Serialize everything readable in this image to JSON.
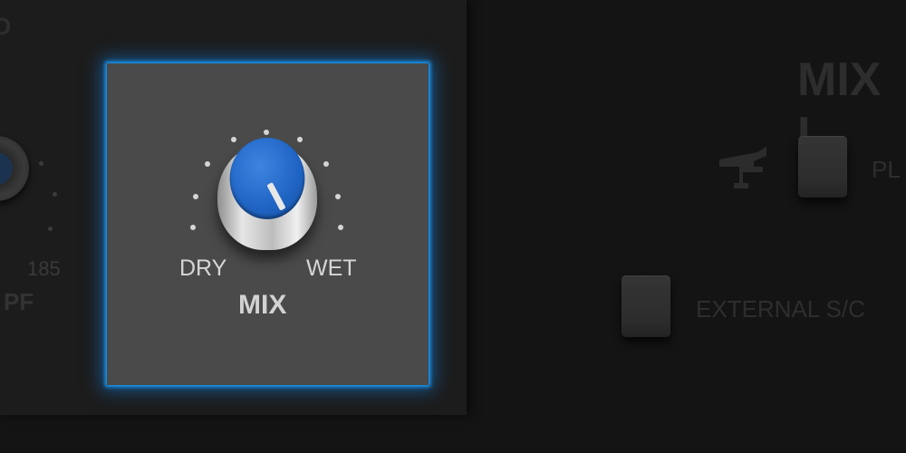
{
  "left_panel": {
    "section_label": "O",
    "lpf_value": "185",
    "lpf_label": "PF"
  },
  "mix_panel": {
    "dry_label": "DRY",
    "wet_label": "WET",
    "mix_label": "MIX",
    "knob_color": "#1f63c2",
    "highlight_color": "#1aa0ff"
  },
  "right_panel": {
    "title": "MIX L",
    "plugin_button_label": "PL",
    "external_sc_label": "EXTERNAL S/C",
    "sidechain_icon": "sidechain-key-icon"
  }
}
